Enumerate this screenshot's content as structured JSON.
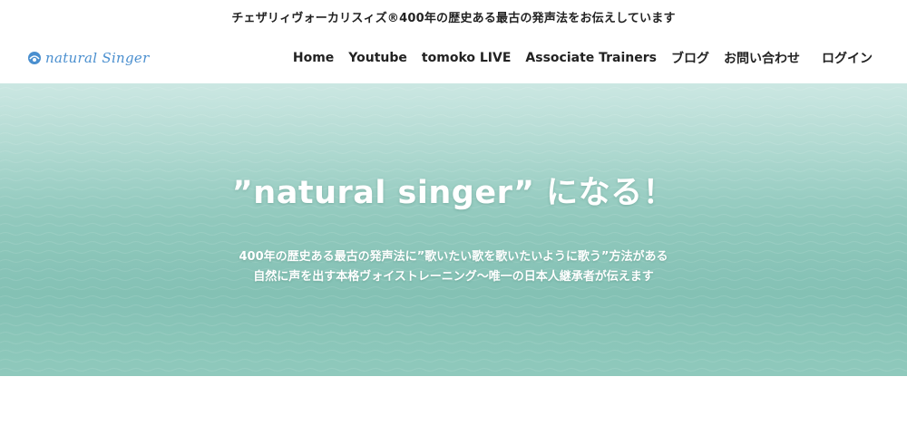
{
  "announcement": "チェザリィヴォーカリスィズ®400年の歴史ある最古の発声法をお伝えしています",
  "logo": {
    "text": "natural Singer",
    "color": "#4a8fcf"
  },
  "nav": {
    "items": [
      {
        "label": "Home"
      },
      {
        "label": "Youtube"
      },
      {
        "label": "tomoko LIVE"
      },
      {
        "label": "Associate Trainers"
      },
      {
        "label": "ブログ"
      },
      {
        "label": "お問い合わせ"
      }
    ],
    "login_label": "ログイン"
  },
  "hero": {
    "title": "”natural singer” になる！",
    "subtitle_line1": "400年の歴史ある最古の発声法に”歌いたい歌を歌いたいように歌う”方法がある",
    "subtitle_line2": "自然に声を出す本格ヴォイストレーニング〜唯一の日本人継承者が伝えます",
    "background": "sea-surface-image"
  }
}
